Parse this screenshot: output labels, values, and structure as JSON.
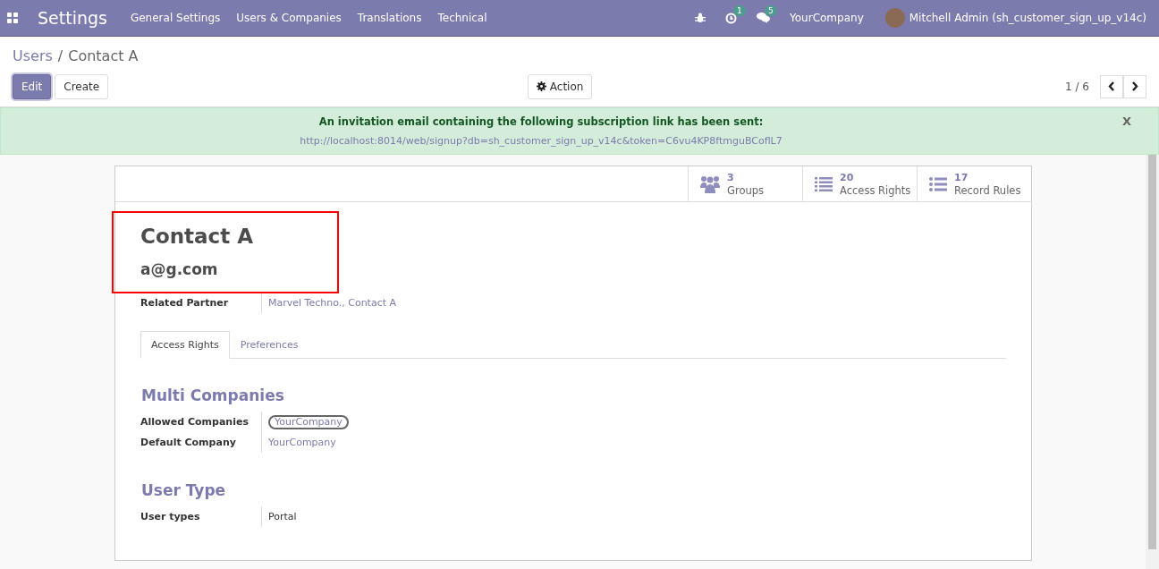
{
  "navbar": {
    "app_title": "Settings",
    "menu": [
      "General Settings",
      "Users & Companies",
      "Translations",
      "Technical"
    ],
    "activity_count": "1",
    "message_count": "5",
    "company": "YourCompany",
    "user": "Mitchell Admin (sh_customer_sign_up_v14c)"
  },
  "breadcrumb": {
    "parent": "Users",
    "separator": "/",
    "current": "Contact A"
  },
  "buttons": {
    "edit": "Edit",
    "create": "Create",
    "action": "Action"
  },
  "pager": {
    "value": "1 / 6"
  },
  "alert": {
    "message": "An invitation email containing the following subscription link has been sent:",
    "link": "http://localhost:8014/web/signup?db=sh_customer_sign_up_v14c&token=C6vu4KP8ftmguBCoflL7",
    "close": "X"
  },
  "stat_buttons": [
    {
      "kind": "groups",
      "count": "3",
      "label": "Groups"
    },
    {
      "kind": "list",
      "count": "20",
      "label": "Access Rights"
    },
    {
      "kind": "bullets",
      "count": "17",
      "label": "Record Rules"
    }
  ],
  "record": {
    "name": "Contact A",
    "email": "a@g.com",
    "highlighted": true
  },
  "fields": [
    {
      "label": "Related Partner",
      "kind": "link",
      "value": "Marvel Techno., Contact A"
    }
  ],
  "tabs": [
    {
      "label": "Access Rights",
      "selected": true
    },
    {
      "label": "Preferences",
      "selected": false
    }
  ],
  "sections": [
    {
      "title": "Multi Companies",
      "fields": [
        {
          "label": "Allowed Companies",
          "kind": "tag",
          "value": "YourCompany"
        },
        {
          "label": "Default Company",
          "kind": "link",
          "value": "YourCompany"
        }
      ]
    },
    {
      "title": "User Type",
      "fields": [
        {
          "label": "User types",
          "kind": "text",
          "value": "Portal"
        }
      ]
    }
  ]
}
